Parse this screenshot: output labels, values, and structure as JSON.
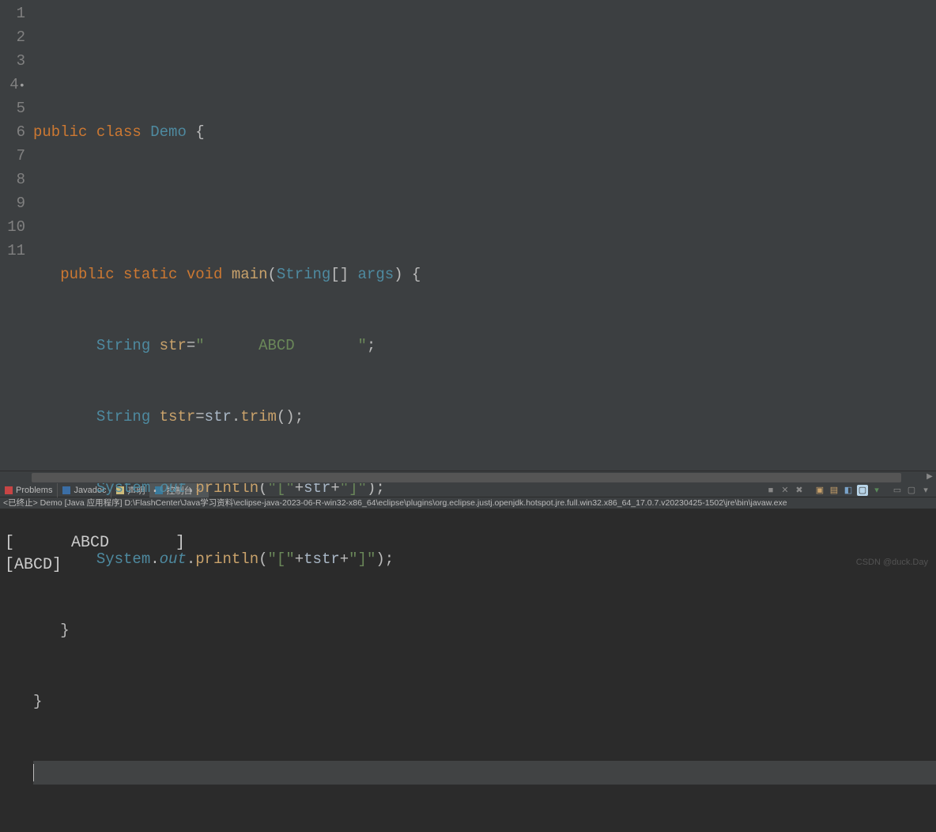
{
  "gutter": [
    "1",
    "2",
    "3",
    "4",
    "5",
    "6",
    "7",
    "8",
    "9",
    "10",
    "11"
  ],
  "line4_marker": "•",
  "code": {
    "l2": {
      "t1": "public class ",
      "t2": "Demo ",
      "t3": "{"
    },
    "l4": {
      "indent": "   ",
      "t1": "public static void ",
      "t2": "main",
      "t3": "(",
      "t4": "String",
      "t5": "[] ",
      "t6": "args",
      "t7": ") {"
    },
    "l5": {
      "indent": "       ",
      "t1": "String ",
      "t2": "str",
      "t3": "=",
      "t4": "\"      ABCD       \"",
      "t5": ";"
    },
    "l6": {
      "indent": "       ",
      "t1": "String ",
      "t2": "tstr",
      "t3": "=",
      "t4": "str",
      "t5": ".",
      "t6": "trim",
      "t7": "();"
    },
    "l7": {
      "indent": "       ",
      "t1": "System",
      "t2": ".",
      "t3": "out",
      "t4": ".",
      "t5": "println",
      "t6": "(",
      "t7": "\"[\"",
      "t8": "+",
      "t9": "str",
      "t10": "+",
      "t11": "\"]\"",
      "t12": ");"
    },
    "l8": {
      "indent": "       ",
      "t1": "System",
      "t2": ".",
      "t3": "out",
      "t4": ".",
      "t5": "println",
      "t6": "(",
      "t7": "\"[\"",
      "t8": "+",
      "t9": "tstr",
      "t10": "+",
      "t11": "\"]\"",
      "t12": ");"
    },
    "l9": {
      "indent": "   ",
      "t1": "}"
    },
    "l10": {
      "t1": "}"
    }
  },
  "tabs": {
    "problems": "Problems",
    "javadoc": "Javadoc",
    "decl": "声明",
    "console": "控制台"
  },
  "status": "<已终止> Demo [Java 应用程序] D:\\FlashCenter\\Java学习资料\\eclipse-java-2023-06-R-win32-x86_64\\eclipse\\plugins\\org.eclipse.justj.openjdk.hotspot.jre.full.win32.x86_64_17.0.7.v20230425-1502\\jre\\bin\\javaw.exe",
  "console_out": {
    "l1": "[      ABCD       ]",
    "l2": "[ABCD]"
  },
  "watermark": "CSDN @duck.Day"
}
